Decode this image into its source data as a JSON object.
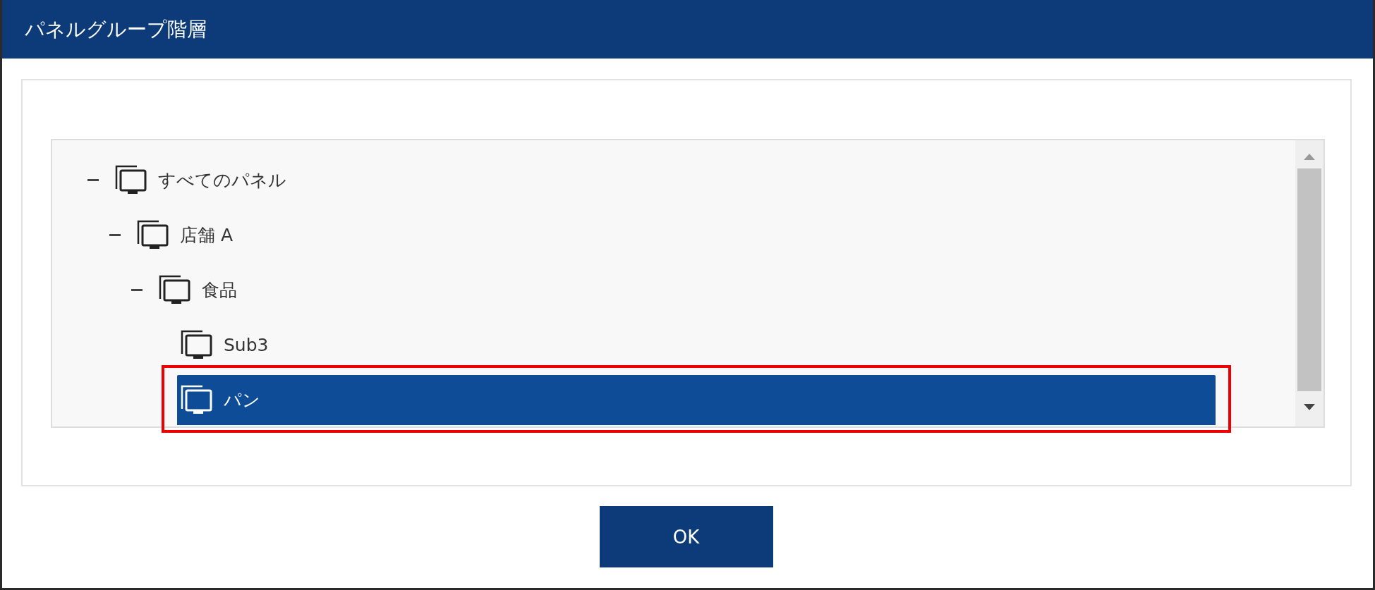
{
  "window": {
    "title": "パネルグループ階層"
  },
  "tree": {
    "nodes": [
      {
        "label": "すべてのパネル",
        "expanded": true,
        "selected": false,
        "highlighted": false,
        "children": [
          {
            "label": "店舗 A",
            "expanded": true,
            "selected": false,
            "highlighted": false,
            "children": [
              {
                "label": "食品",
                "expanded": true,
                "selected": false,
                "highlighted": false,
                "children": [
                  {
                    "label": "Sub3",
                    "selected": false,
                    "highlighted": false
                  },
                  {
                    "label": "パン",
                    "selected": true,
                    "highlighted": true
                  }
                ]
              }
            ]
          }
        ]
      }
    ]
  },
  "buttons": [
    {
      "label": "OK"
    }
  ]
}
